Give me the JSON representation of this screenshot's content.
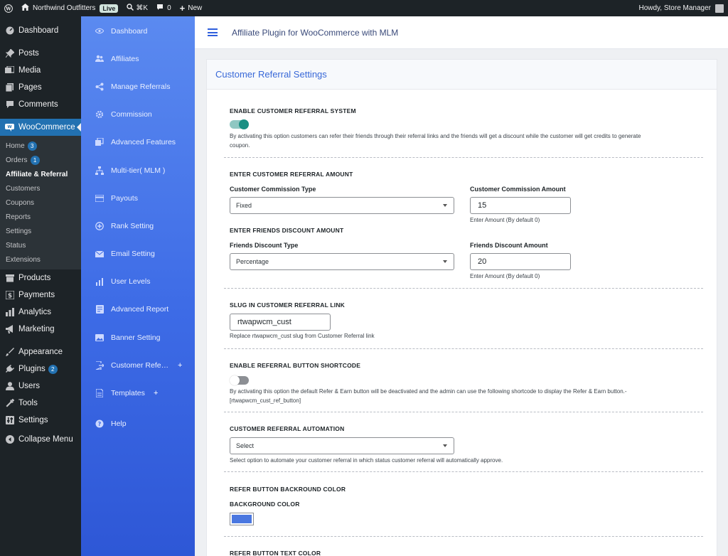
{
  "adminbar": {
    "site_name": "Northwind Outfitters",
    "live_badge": "Live",
    "shortcut": "⌘K",
    "comments_count": "0",
    "new_label": "New",
    "greeting": "Howdy, Store Manager"
  },
  "wpmenu": {
    "dashboard": "Dashboard",
    "posts": "Posts",
    "media": "Media",
    "pages": "Pages",
    "comments": "Comments",
    "woocommerce": "WooCommerce",
    "sub": {
      "home": "Home",
      "home_badge": "3",
      "orders": "Orders",
      "orders_badge": "1",
      "affiliate": "Affiliate & Referral",
      "customers": "Customers",
      "coupons": "Coupons",
      "reports": "Reports",
      "settings": "Settings",
      "status": "Status",
      "extensions": "Extensions"
    },
    "products": "Products",
    "payments": "Payments",
    "analytics": "Analytics",
    "marketing": "Marketing",
    "appearance": "Appearance",
    "plugins": "Plugins",
    "plugins_badge": "2",
    "users": "Users",
    "tools": "Tools",
    "settings": "Settings",
    "collapse": "Collapse Menu"
  },
  "pluginnav": [
    {
      "label": "Dashboard",
      "icon": "eye-icon"
    },
    {
      "label": "Affiliates",
      "icon": "users-icon"
    },
    {
      "label": "Manage Referrals",
      "icon": "share-icon"
    },
    {
      "label": "Commission",
      "icon": "gear-icon"
    },
    {
      "label": "Advanced Features",
      "icon": "layers-icon"
    },
    {
      "label": "Multi-tier( MLM )",
      "icon": "network-icon"
    },
    {
      "label": "Payouts",
      "icon": "card-icon"
    },
    {
      "label": "Rank Setting",
      "icon": "plus-circle-icon"
    },
    {
      "label": "Email Setting",
      "icon": "mail-icon"
    },
    {
      "label": "User Levels",
      "icon": "bars-icon"
    },
    {
      "label": "Advanced Report",
      "icon": "report-icon"
    },
    {
      "label": "Banner Setting",
      "icon": "image-icon"
    },
    {
      "label": "Customer Refe…",
      "icon": "door-icon",
      "plus": "+"
    },
    {
      "label": "Templates",
      "icon": "doc-icon",
      "plus": "+"
    },
    {
      "label": "Help",
      "icon": "help-icon"
    }
  ],
  "header": {
    "title": "Affiliate Plugin for WooCommerce with MLM"
  },
  "card": {
    "title": "Customer Referral Settings"
  },
  "settings": {
    "enable_system": {
      "label": "ENABLE CUSTOMER REFERRAL SYSTEM",
      "toggle_on": true,
      "desc1": "By activating this option customers can refer their friends through their referral links and the friends will get a discount while the customer will get credits to generate",
      "desc2": "coupon."
    },
    "referral_amount": {
      "label": "ENTER CUSTOMER REFERRAL AMOUNT",
      "type_label": "Customer Commission Type",
      "type_value": "Fixed",
      "amount_label": "Customer Commission Amount",
      "amount_value": "15",
      "amount_hint": "Enter Amount (By default 0)"
    },
    "friends_discount": {
      "label": "ENTER FRIENDS DISCOUNT AMOUNT",
      "type_label": "Friends Discount Type",
      "type_value": "Percentage",
      "amount_label": "Friends Discount Amount",
      "amount_value": "20",
      "amount_hint": "Enter Amount (By default 0)"
    },
    "slug": {
      "label": "SLUG IN CUSTOMER REFERRAL LINK",
      "value": "rtwapwcm_cust",
      "hint": "Replace rtwapwcm_cust slug from Customer Referral link"
    },
    "shortcode": {
      "label": "ENABLE REFERRAL BUTTON SHORTCODE",
      "toggle_on": false,
      "desc1": "By activating this option the default Refer & Earn button will be deactivated and the admin can use the following shortcode to display the Refer & Earn button.-",
      "desc2": "[rtwapwcm_cust_ref_button]"
    },
    "automation": {
      "label": "CUSTOMER REFERRAL AUTOMATION",
      "value": "Select",
      "hint": "Select option to automate your customer referral in which status customer referral will automatically approve."
    },
    "bg_color": {
      "label": "REFER BUTTON BACKROUND COLOR",
      "sub_label": "BACKGROUND COLOR",
      "color": "#4a77e0"
    },
    "text_color": {
      "label": "REFER BUTTON TEXT COLOR"
    }
  },
  "colors": {
    "accent": "#2271b1",
    "plugin_blue": "#3d6be6",
    "title_blue": "#3868d8",
    "toggle_on": "#1a8f83"
  }
}
